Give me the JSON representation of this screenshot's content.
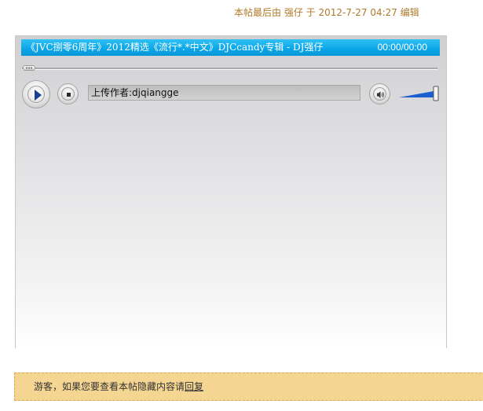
{
  "post": {
    "edit_note": "本帖最后由 强仔 于 2012-7-27 04:27 编辑"
  },
  "player": {
    "track_title": "《JVC捌零6周年》2012精选《流行*.*中文》DJCcandy专辑 - DJ强仔",
    "time_display": "00:00/00:00",
    "uploader_text": "上传作者:djqiangge",
    "progress": 0,
    "volume": 1,
    "colors": {
      "titlebar": "#0aa6e8",
      "volume_fill": "#1a5fd0"
    },
    "icons": {
      "play": "play-icon",
      "stop": "stop-icon",
      "volume": "speaker-icon"
    }
  },
  "notice": {
    "prefix": "游客，如果您要查看本帖隐藏内容请",
    "reply_link": "回复",
    "background": "#f5d592"
  }
}
